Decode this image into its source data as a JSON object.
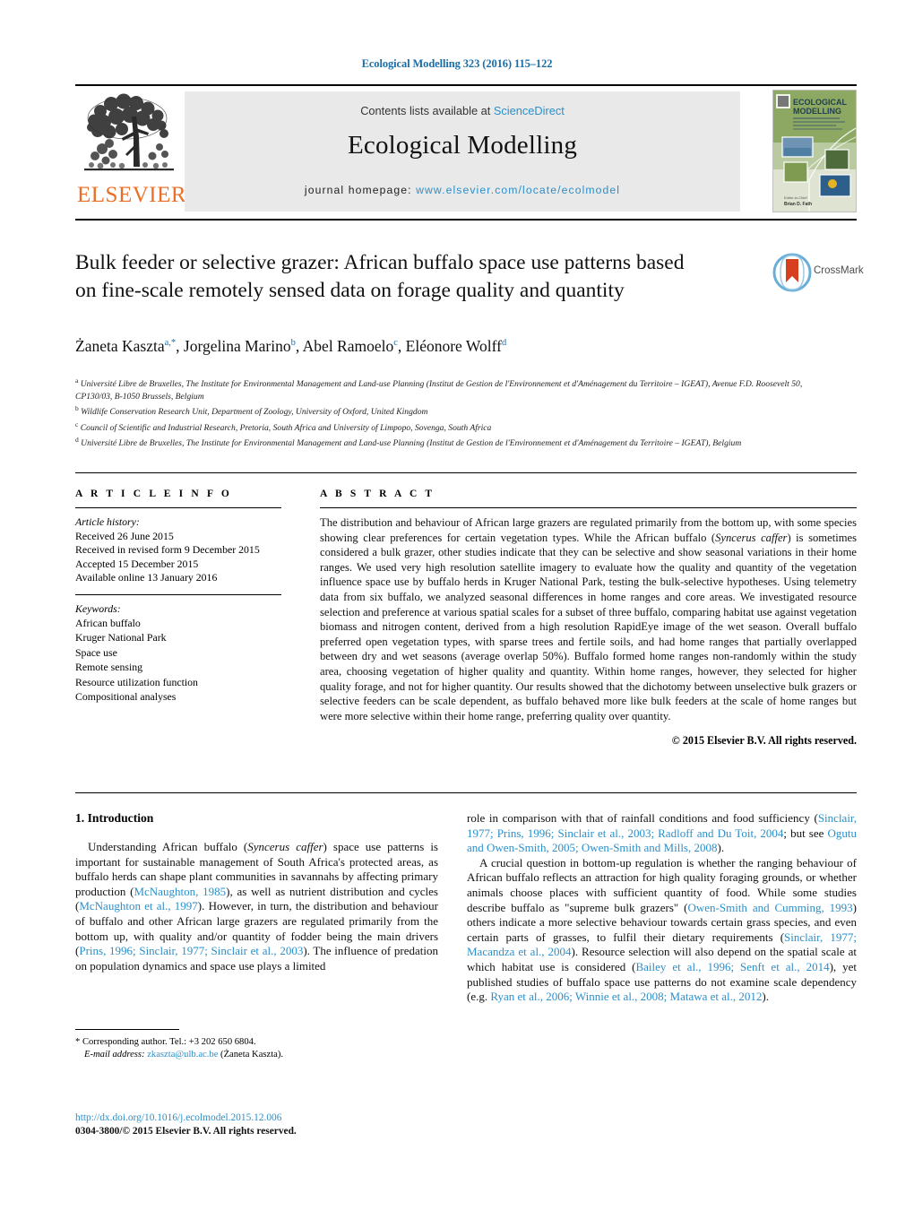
{
  "running_head": "Ecological Modelling 323 (2016) 115–122",
  "masthead": {
    "publisher_name": "ELSEVIER",
    "contents_prefix": "Contents lists available at ",
    "contents_link": "ScienceDirect",
    "journal_title": "Ecological Modelling",
    "homepage_prefix": "journal homepage: ",
    "homepage_url": "www.elsevier.com/locate/ecolmodel",
    "cover_title_line1": "ECOLOGICAL",
    "cover_title_line2": "MODELLING"
  },
  "article": {
    "title": "Bulk feeder or selective grazer: African buffalo space use patterns based on fine-scale remotely sensed data on forage quality and quantity",
    "crossmark_label": "CrossMark",
    "authors_html": "Żaneta Kaszta<sup>a,*</sup>, Jorgelina Marino<sup>b</sup>, Abel Ramoelo<sup>c</sup>, Eléonore Wolff<sup>d</sup>",
    "affiliations": [
      "Université Libre de Bruxelles, The Institute for Environmental Management and Land-use Planning (Institut de Gestion de l'Environnement et d'Aménagement du Territoire – IGEAT), Avenue F.D. Roosevelt 50, CP130/03, B-1050 Brussels, Belgium",
      "Wildlife Conservation Research Unit, Department of Zoology, University of Oxford, United Kingdom",
      "Council of Scientific and Industrial Research, Pretoria, South Africa and University of Limpopo, Sovenga, South Africa",
      "Université Libre de Bruxelles, The Institute for Environmental Management and Land-use Planning (Institut de Gestion de l'Environnement et d'Aménagement du Territoire – IGEAT), Belgium"
    ],
    "affiliation_markers": [
      "a",
      "b",
      "c",
      "d"
    ]
  },
  "article_info": {
    "heading": "A R T I C L E   I N F O",
    "history_label": "Article history:",
    "history": [
      "Received 26 June 2015",
      "Received in revised form 9 December 2015",
      "Accepted 15 December 2015",
      "Available online 13 January 2016"
    ],
    "keywords_label": "Keywords:",
    "keywords": [
      "African buffalo",
      "Kruger National Park",
      "Space use",
      "Remote sensing",
      "Resource utilization function",
      "Compositional analyses"
    ]
  },
  "abstract": {
    "heading": "A B S T R A C T",
    "body_html": "The distribution and behaviour of African large grazers are regulated primarily from the bottom up, with some species showing clear preferences for certain vegetation types. While the African buffalo (<em>Syncerus caffer</em>) is sometimes considered a bulk grazer, other studies indicate that they can be selective and show seasonal variations in their home ranges. We used very high resolution satellite imagery to evaluate how the quality and quantity of the vegetation influence space use by buffalo herds in Kruger National Park, testing the bulk-selective hypotheses. Using telemetry data from six buffalo, we analyzed seasonal differences in home ranges and core areas. We investigated resource selection and preference at various spatial scales for a subset of three buffalo, comparing habitat use against vegetation biomass and nitrogen content, derived from a high resolution RapidEye image of the wet season. Overall buffalo preferred open vegetation types, with sparse trees and fertile soils, and had home ranges that partially overlapped between dry and wet seasons (average overlap 50%). Buffalo formed home ranges non-randomly within the study area, choosing vegetation of higher quality and quantity. Within home ranges, however, they selected for higher quality forage, and not for higher quantity. Our results showed that the dichotomy between unselective bulk grazers or selective feeders can be scale dependent, as buffalo behaved more like bulk feeders at the scale of home ranges but were more selective within their home range, preferring quality over quantity.",
    "copyright": "© 2015 Elsevier B.V. All rights reserved."
  },
  "introduction": {
    "section_title": "1.  Introduction",
    "left_paragraphs_html": [
      "Understanding African buffalo (<em>Syncerus caffer</em>) space use patterns is important for sustainable management of South Africa's protected areas, as buffalo herds can shape plant communities in savannahs by affecting primary production (<span class=\"ref\">McNaughton, 1985</span>), as well as nutrient distribution and cycles (<span class=\"ref\">McNaughton et al., 1997</span>). However, in turn, the distribution and behaviour of buffalo and other African large grazers are regulated primarily from the bottom up, with quality and/or quantity of fodder being the main drivers (<span class=\"ref\">Prins, 1996; Sinclair, 1977; Sinclair et al., 2003</span>). The influence of predation on population dynamics and space use plays a limited"
    ],
    "right_paragraphs_html": [
      "role in comparison with that of rainfall conditions and food sufficiency (<span class=\"ref\">Sinclair, 1977; Prins, 1996; Sinclair et al., 2003; Radloff and Du Toit, 2004</span>; but see <span class=\"ref\">Ogutu and Owen-Smith, 2005; Owen-Smith and Mills, 2008</span>).",
      "A crucial question in bottom-up regulation is whether the ranging behaviour of African buffalo reflects an attraction for high quality foraging grounds, or whether animals choose places with sufficient quantity of food. While some studies describe buffalo as \"supreme bulk grazers\" (<span class=\"ref\">Owen-Smith and Cumming, 1993</span>) others indicate a more selective behaviour towards certain grass species, and even certain parts of grasses, to fulfil their dietary requirements (<span class=\"ref\">Sinclair, 1977; Macandza et al., 2004</span>). Resource selection will also depend on the spatial scale at which habitat use is considered (<span class=\"ref\">Bailey et al., 1996; Senft et al., 2014</span>), yet published studies of buffalo space use patterns do not examine scale dependency (e.g. <span class=\"ref\">Ryan et al., 2006; Winnie et al., 2008; Matawa et al., 2012</span>)."
    ]
  },
  "footnotes": {
    "corresponding_html": "* Corresponding author. Tel.: +3 202 650 6804.",
    "email_html": "<em>E-mail address:</em> <span class=\"fn-mail\">zkaszta@ulb.ac.be</span> (Żaneta Kaszta).",
    "doi": "http://dx.doi.org/10.1016/j.ecolmodel.2015.12.006",
    "issn_copyright": "0304-3800/© 2015 Elsevier B.V. All rights reserved."
  },
  "colors": {
    "link_blue": "#2c8fc9",
    "header_blue": "#1a6ea8",
    "elsevier_orange": "#eb6e26",
    "band_grey": "#e9e9e9"
  }
}
